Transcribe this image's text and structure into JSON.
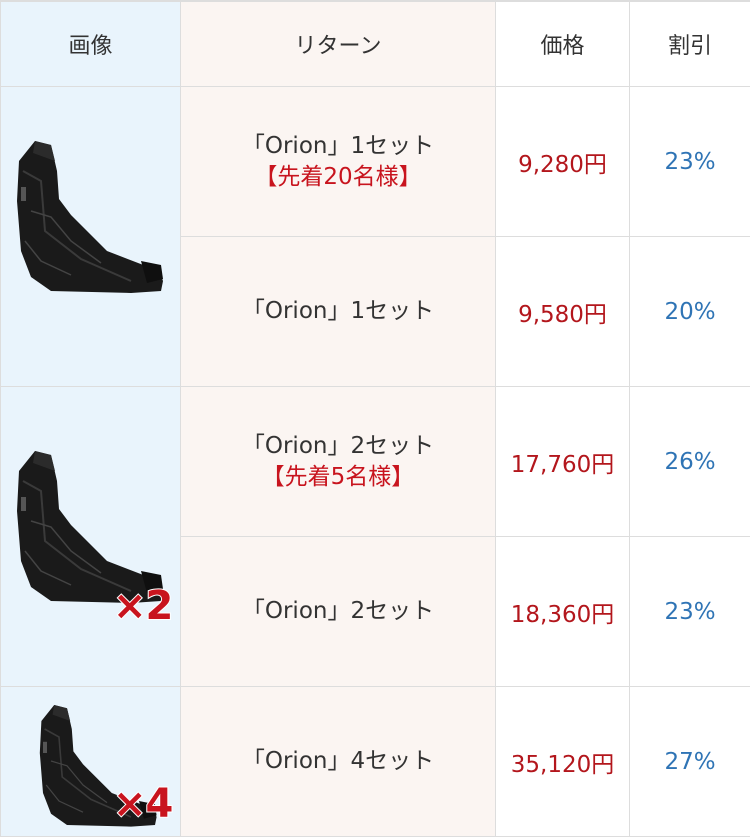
{
  "header": {
    "image": "画像",
    "return": "リターン",
    "price": "価格",
    "discount": "割引"
  },
  "rows": [
    {
      "name": "「Orion」1セット",
      "promo": "【先着20名様】",
      "price": "9,280円",
      "discount": "23%"
    },
    {
      "name": "「Orion」1セット",
      "promo": "",
      "price": "9,580円",
      "discount": "20%"
    },
    {
      "name": "「Orion」2セット",
      "promo": "【先着5名様】",
      "price": "17,760円",
      "discount": "26%"
    },
    {
      "name": "「Orion」2セット",
      "promo": "",
      "price": "18,360円",
      "discount": "23%"
    },
    {
      "name": "「Orion」4セット",
      "promo": "",
      "price": "35,120円",
      "discount": "27%"
    }
  ],
  "images": [
    {
      "icon": "sling-bag-icon",
      "multiplier": ""
    },
    {
      "icon": "sling-bag-icon",
      "multiplier": "×2"
    },
    {
      "icon": "sling-bag-icon",
      "multiplier": "×4"
    }
  ],
  "colors": {
    "price": "#b3161c",
    "discount": "#2f74b5",
    "promo": "#c8141e",
    "image_column_bg": "#e9f4fc",
    "return_column_bg": "#fbf5f2"
  }
}
